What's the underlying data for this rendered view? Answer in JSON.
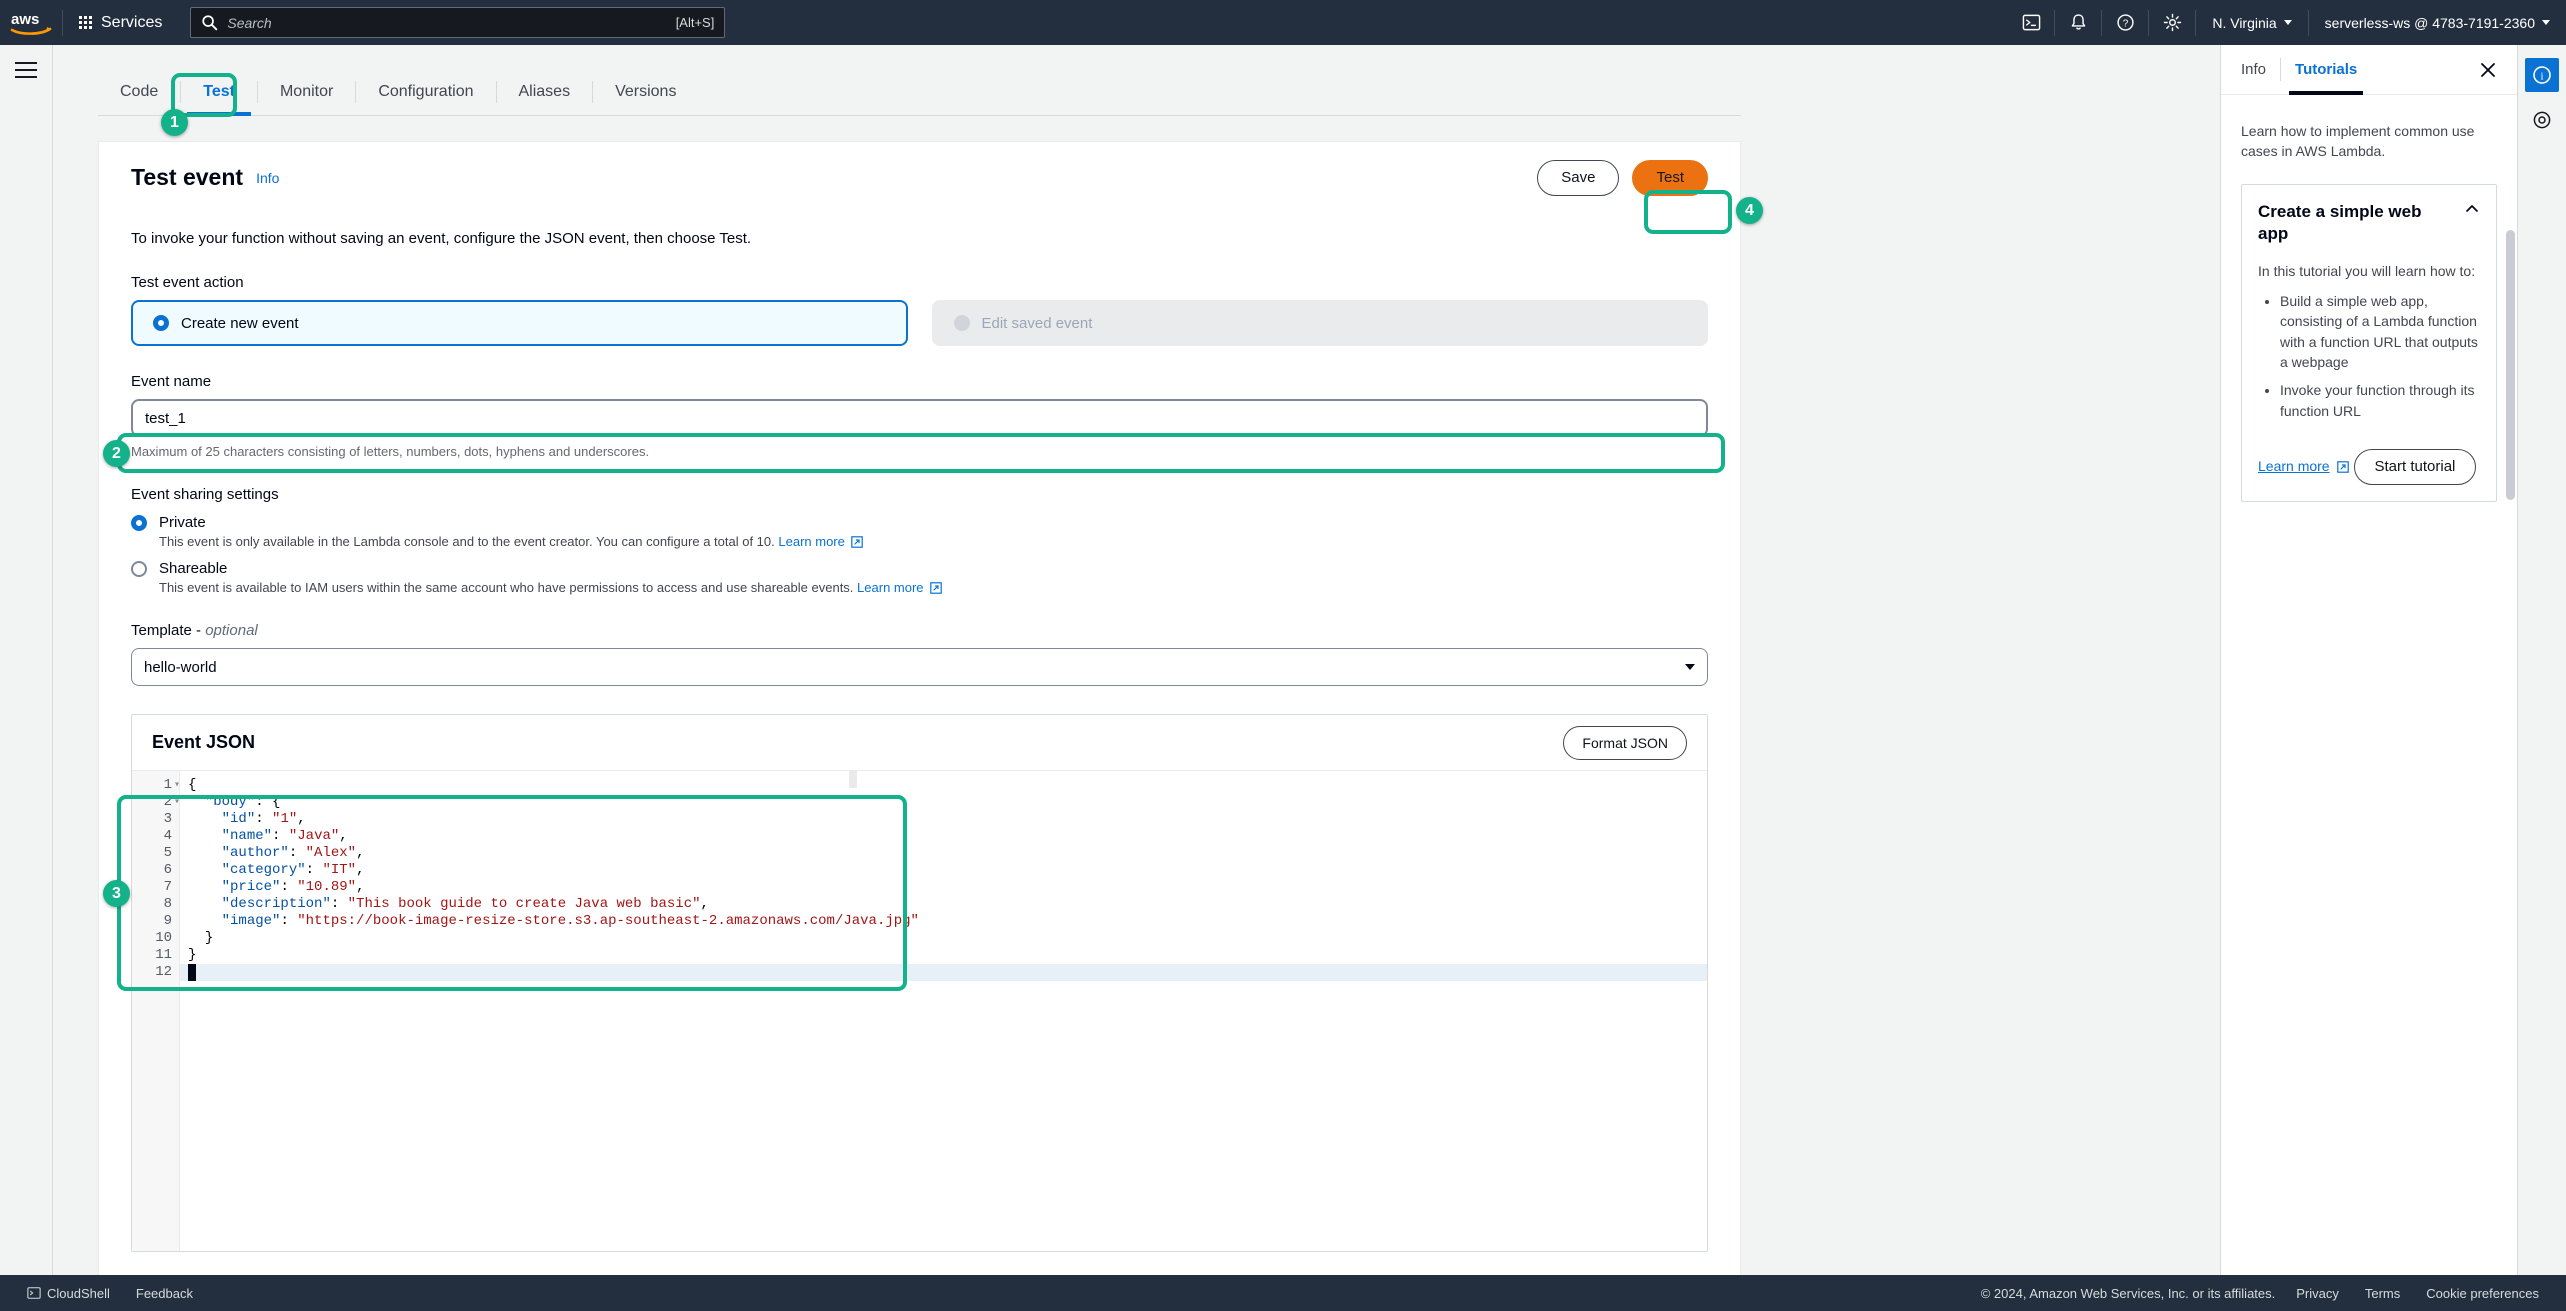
{
  "topnav": {
    "logo": "aws-logo",
    "services_label": "Services",
    "search_placeholder": "Search",
    "search_value": "",
    "search_shortcut": "[Alt+S]",
    "icons": [
      "cloudshell-icon",
      "notifications-bell-icon",
      "help-question-icon",
      "settings-gear-icon"
    ],
    "region": "N. Virginia",
    "account": "serverless-ws @ 4783-7191-2360"
  },
  "tabs": [
    {
      "label": "Code",
      "active": false
    },
    {
      "label": "Test",
      "active": true
    },
    {
      "label": "Monitor",
      "active": false
    },
    {
      "label": "Configuration",
      "active": false
    },
    {
      "label": "Aliases",
      "active": false
    },
    {
      "label": "Versions",
      "active": false
    }
  ],
  "page": {
    "title": "Test event",
    "info_label": "Info",
    "save_label": "Save",
    "test_label": "Test",
    "intro": "To invoke your function without saving an event, configure the JSON event, then choose Test."
  },
  "test_event_action": {
    "label": "Test event action",
    "options": [
      {
        "label": "Create new event",
        "selected": true,
        "disabled": false
      },
      {
        "label": "Edit saved event",
        "selected": false,
        "disabled": true
      }
    ]
  },
  "event_name": {
    "label": "Event name",
    "value": "test_1",
    "placeholder": "",
    "hint": "Maximum of 25 characters consisting of letters, numbers, dots, hyphens and underscores."
  },
  "sharing": {
    "label": "Event sharing settings",
    "options": [
      {
        "label": "Private",
        "selected": true,
        "desc": "This event is only available in the Lambda console and to the event creator. You can configure a total of 10.",
        "learn_more": "Learn more"
      },
      {
        "label": "Shareable",
        "selected": false,
        "desc": "This event is available to IAM users within the same account who have permissions to access and use shareable events.",
        "learn_more": "Learn more"
      }
    ]
  },
  "template": {
    "label": "Template - ",
    "label_optional": "optional",
    "value": "hello-world"
  },
  "editor": {
    "title": "Event JSON",
    "format_label": "Format JSON",
    "lines": [
      {
        "n": "1",
        "fold": true,
        "text": "{"
      },
      {
        "n": "2",
        "fold": true,
        "text": "  \"body\": {"
      },
      {
        "n": "3",
        "fold": false,
        "text": "    \"id\": \"1\","
      },
      {
        "n": "4",
        "fold": false,
        "text": "    \"name\": \"Java\","
      },
      {
        "n": "5",
        "fold": false,
        "text": "    \"author\": \"Alex\","
      },
      {
        "n": "6",
        "fold": false,
        "text": "    \"category\": \"IT\","
      },
      {
        "n": "7",
        "fold": false,
        "text": "    \"price\": \"10.89\","
      },
      {
        "n": "8",
        "fold": false,
        "text": "    \"description\": \"This book guide to create Java web basic\","
      },
      {
        "n": "9",
        "fold": false,
        "text": "    \"image\": \"https://book-image-resize-store.s3.ap-southeast-2.amazonaws.com/Java.jpg\""
      },
      {
        "n": "10",
        "fold": false,
        "text": "  }"
      },
      {
        "n": "11",
        "fold": false,
        "text": "}"
      },
      {
        "n": "12",
        "fold": false,
        "text": ""
      }
    ]
  },
  "annotations": [
    {
      "badge": "1",
      "target": "tab-code"
    },
    {
      "badge": "2",
      "target": "event-name-input"
    },
    {
      "badge": "3",
      "target": "event-json-editor"
    },
    {
      "badge": "4",
      "target": "test-button"
    }
  ],
  "right_panel": {
    "tabs": [
      {
        "label": "Info",
        "active": false
      },
      {
        "label": "Tutorials",
        "active": true
      }
    ],
    "close_icon": "close-icon",
    "intro": "Learn how to implement common use cases in AWS Lambda.",
    "tutorial": {
      "title": "Create a simple web app",
      "expanded": true,
      "subtitle": "In this tutorial you will learn how to:",
      "bullets": [
        "Build a simple web app, consisting of a Lambda function with a function URL that outputs a webpage",
        "Invoke your function through its function URL"
      ],
      "learn_more": "Learn more",
      "start_label": "Start tutorial"
    }
  },
  "footer": {
    "cloudshell": "CloudShell",
    "feedback": "Feedback",
    "copyright": "© 2024, Amazon Web Services, Inc. or its affiliates.",
    "links": [
      "Privacy",
      "Terms",
      "Cookie preferences"
    ]
  },
  "colors": {
    "nav_bg": "#232f3e",
    "accent_blue": "#0972d3",
    "primary_orange": "#ec7211",
    "annotation_teal": "#14b28a"
  }
}
